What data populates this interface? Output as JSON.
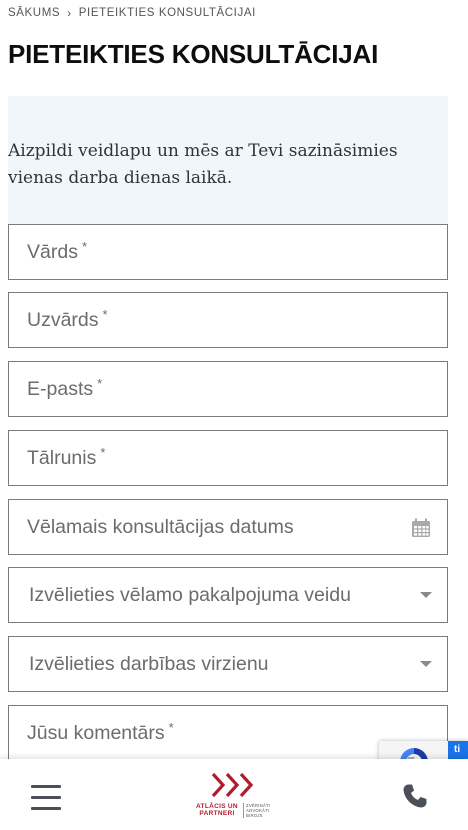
{
  "breadcrumb": {
    "home": "SĀKUMS",
    "separator": "›",
    "current": "PIETEIKTIES KONSULTĀCIJAI"
  },
  "page": {
    "title": "PIETEIKTIES KONSULTĀCIJAI",
    "intro": "Aizpildi veidlapu un mēs ar Tevi sazināsimies vienas darba dienas laikā."
  },
  "form": {
    "required_mark": "*",
    "first_name": {
      "placeholder": "Vārds",
      "value": ""
    },
    "last_name": {
      "placeholder": "Uzvārds",
      "value": ""
    },
    "email": {
      "placeholder": "E-pasts",
      "value": ""
    },
    "phone": {
      "placeholder": "Tālrunis",
      "value": ""
    },
    "date": {
      "placeholder": "Vēlamais konsultācijas datums",
      "value": "",
      "icon": "calendar-icon"
    },
    "service_type": {
      "selected": "Izvēlieties vēlamo pakalpojuma veidu",
      "icon": "chevron-down-icon"
    },
    "field_of_activity": {
      "selected": "Izvēlieties darbības virzienu",
      "icon": "chevron-down-icon"
    },
    "comment": {
      "placeholder": "Jūsu komentārs",
      "value": ""
    }
  },
  "recaptcha": {
    "tab_text": "ti"
  },
  "bottom_bar": {
    "menu_icon": "hamburger-menu-icon",
    "phone_icon": "phone-icon",
    "logo": {
      "name_line1": "ATLĀCIS UN",
      "name_line2": "PARTNERI",
      "sub_line1": "ZVĒRINĀTI",
      "sub_line2": "ADVOKĀTI",
      "sub_line3": "BIROJS"
    }
  },
  "colors": {
    "accent": "#b01c2e",
    "intro_background": "#f1f6fb",
    "field_border": "#7b7b7b",
    "placeholder_text": "#6c6c6c"
  }
}
